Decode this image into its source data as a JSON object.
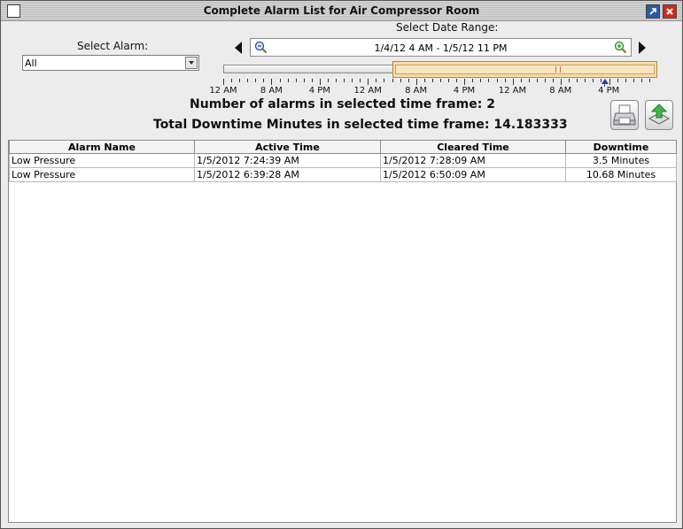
{
  "window": {
    "title": "Complete Alarm List for Air Compressor Room"
  },
  "filters": {
    "select_alarm_label": "Select Alarm:",
    "select_alarm_value": "All",
    "date_range_label": "Select Date Range:",
    "date_range_value": "1/4/12 4 AM - 1/5/12 11 PM"
  },
  "timeline": {
    "tick_labels": [
      "12 AM",
      "8 AM",
      "4 PM",
      "12 AM",
      "8 AM",
      "4 PM",
      "12 AM",
      "8 AM",
      "4 PM"
    ]
  },
  "stats": {
    "count_label": "Number of alarms in selected time frame:",
    "count_value": "2",
    "downtime_label": "Total Downtime Minutes in selected time frame:",
    "downtime_value": "14.183333"
  },
  "table": {
    "columns": [
      "Alarm Name",
      "Active Time",
      "Cleared Time",
      "Downtime"
    ],
    "rows": [
      [
        "Low Pressure",
        "1/5/2012 7:24:39 AM",
        "1/5/2012 7:28:09 AM",
        "3.5 Minutes"
      ],
      [
        "Low Pressure",
        "1/5/2012 6:39:28 AM",
        "1/5/2012 6:50:09 AM",
        "10.68 Minutes"
      ]
    ]
  },
  "icons": {
    "restore": "restore-icon",
    "close": "close-icon",
    "zoom_out": "zoom-out-icon",
    "zoom_in": "zoom-in-icon",
    "print": "printer-icon",
    "export": "export-icon"
  },
  "colors": {
    "timeline_window": "#f6dca8",
    "close_button": "#d02b1e",
    "restore_button": "#2d5aa6",
    "now_marker": "#1f3fae"
  }
}
